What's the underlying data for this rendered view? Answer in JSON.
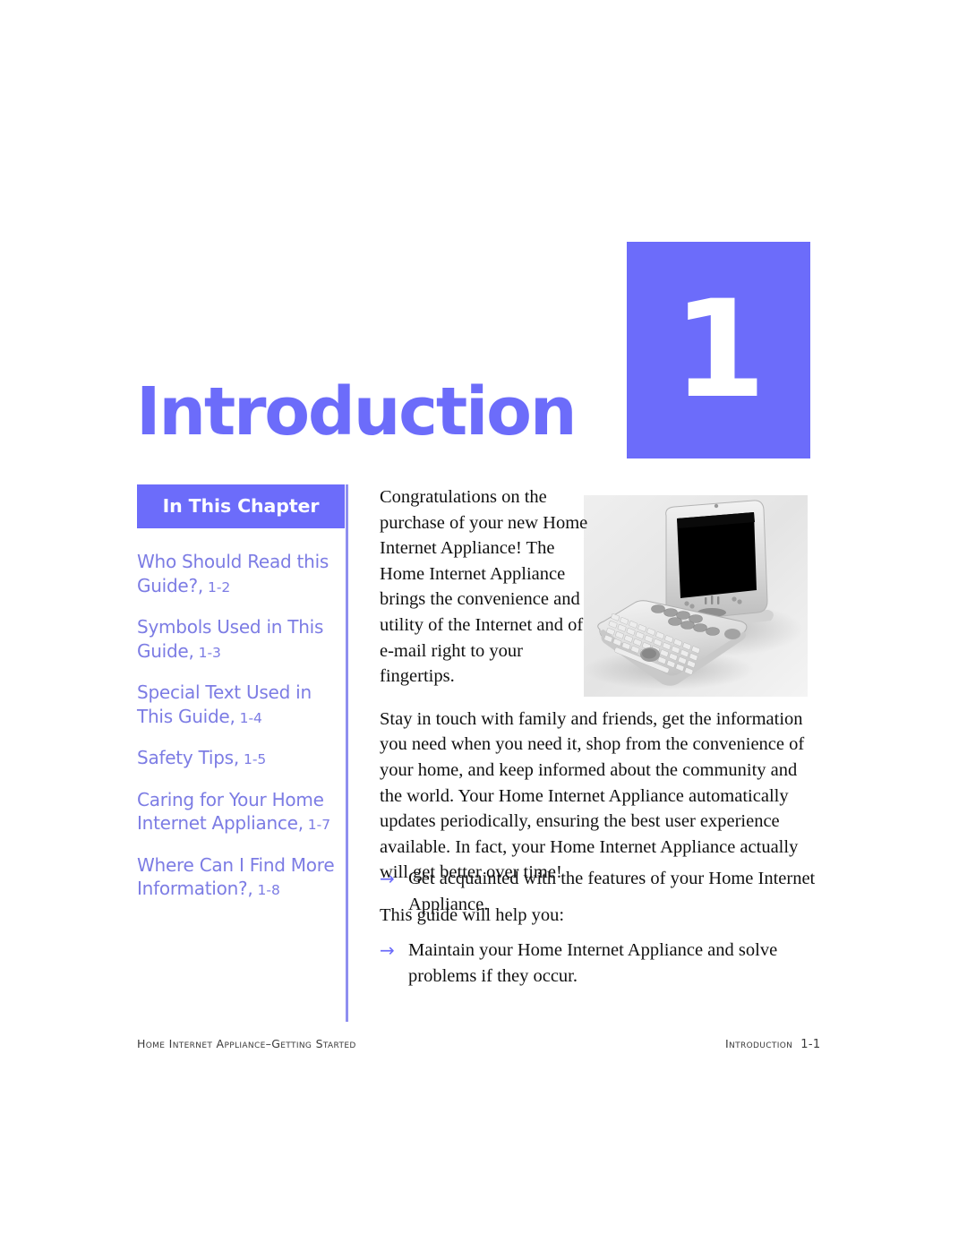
{
  "colors": {
    "accent_purple": "#6c6cfa",
    "link_purple": "#7c7ce4",
    "divider_purple": "#8e8ef0",
    "body_text": "#111111",
    "page_background": "#ffffff"
  },
  "chapter": {
    "number": "1",
    "title": "Introduction"
  },
  "sidebar": {
    "header": "In This Chapter",
    "items": [
      {
        "label": "Who Should Read this Guide?,",
        "page": "1-2"
      },
      {
        "label": "Symbols Used in This Guide,",
        "page": "1-3"
      },
      {
        "label": "Special Text Used in This Guide,",
        "page": "1-4"
      },
      {
        "label": "Safety Tips,",
        "page": "1-5"
      },
      {
        "label": "Caring for Your Home Internet Appliance,",
        "page": "1-7"
      },
      {
        "label": "Where Can I Find More Information?,",
        "page": "1-8"
      }
    ]
  },
  "photo": {
    "alt": "Home Internet Appliance: flat-panel monitor with separate keyboard",
    "icon": "appliance-photo"
  },
  "body": {
    "paragraphs": [
      "Congratulations on the purchase of your new Home Internet Appliance! The Home Internet Appliance brings the convenience and utility of the Internet and of e-mail right to your fingertips.",
      "Stay in touch with family and friends, get the information you need when you need it, shop from the convenience of your home, and keep informed about the community and the world. Your Home Internet Appliance automatically updates periodically, ensuring the best user experience available. In fact, your Home Internet Appliance actually will get better over time!",
      "This guide will help you:"
    ],
    "bullet_marker": "→",
    "bullets": [
      "Get acquainted with the features of your Home Internet Appliance.",
      "Maintain your Home Internet Appliance and solve problems if they occur."
    ]
  },
  "footer": {
    "left": "Home Internet Appliance–Getting Started",
    "right_label": "Introduction",
    "right_page": "1-1"
  }
}
